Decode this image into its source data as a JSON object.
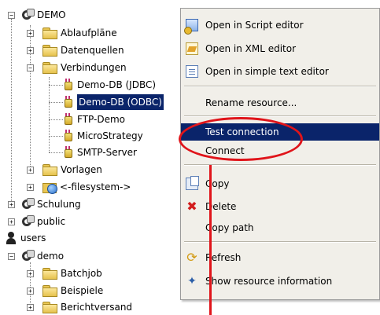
{
  "tree": {
    "demo": "DEMO",
    "ablauf": "Ablaufpläne",
    "datenquellen": "Datenquellen",
    "verbindungen": "Verbindungen",
    "conn_jdbc": "Demo-DB (JDBC)",
    "conn_odbc": "Demo-DB (ODBC)",
    "ftp": "FTP-Demo",
    "micro": "MicroStrategy",
    "smtp": "SMTP-Server",
    "vorlagen": "Vorlagen",
    "filesystem": "<-filesystem->",
    "schulung": "Schulung",
    "public": "public",
    "users": "users",
    "demo2": "demo",
    "batchjob": "Batchjob",
    "beispiele": "Beispiele",
    "berichtversand": "Berichtversand"
  },
  "menu": {
    "open_script": "Open in Script editor",
    "open_xml": "Open in XML editor",
    "open_text": "Open in simple text editor",
    "rename": "Rename resource...",
    "test": "Test connection",
    "connect": "Connect",
    "copy": "Copy",
    "delete": "Delete",
    "copy_path": "Copy path",
    "refresh": "Refresh",
    "show_info": "Show resource information"
  },
  "colors": {
    "selection": "#0a246a",
    "menu_bg": "#f1efe9",
    "annotation": "#e0141a"
  }
}
